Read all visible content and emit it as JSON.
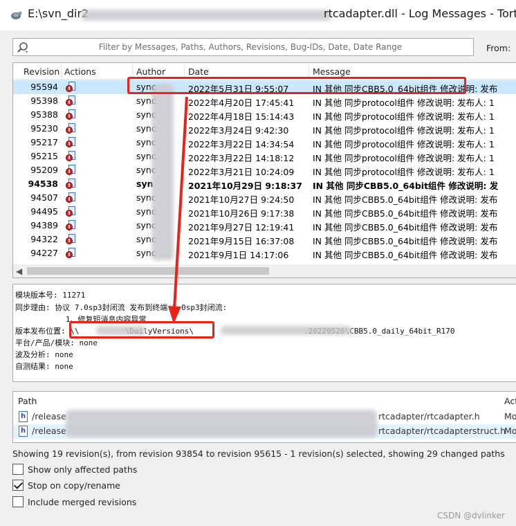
{
  "window": {
    "title_prefix": "E:\\svn_dir2",
    "title_suffix": "rtcadapter.dll - Log Messages - Tortc"
  },
  "filter": {
    "placeholder": "Filter by Messages, Paths, Authors, Revisions, Bug-IDs, Date, Date Range",
    "from_label": "From:"
  },
  "log": {
    "columns": [
      "Revision",
      "Actions",
      "Author",
      "Date",
      "Message"
    ],
    "rows": [
      {
        "revision": "95594",
        "author": "sync",
        "date": "2022年5月31日 9:55:07",
        "message": "IN 其他 同步CBB5.0_64bit组件  修改说明: 发布",
        "selected": true,
        "bold": false
      },
      {
        "revision": "95398",
        "author": "sync",
        "date": "2022年4月20日 17:45:41",
        "message": "IN 其他 同步protocol组件  修改说明: 发布人: 1",
        "selected": false,
        "bold": false
      },
      {
        "revision": "95388",
        "author": "sync",
        "date": "2022年4月18日 15:14:43",
        "message": "IN 其他 同步protocol组件  修改说明: 发布人: 1",
        "selected": false,
        "bold": false
      },
      {
        "revision": "95230",
        "author": "sync",
        "date": "2022年3月24日 9:42:30",
        "message": "IN 其他 同步protocol组件  修改说明: 发布人: 1",
        "selected": false,
        "bold": false
      },
      {
        "revision": "95217",
        "author": "sync",
        "date": "2022年3月22日 14:34:54",
        "message": "IN 其他 同步protocol组件  修改说明: 发布人: 1",
        "selected": false,
        "bold": false
      },
      {
        "revision": "95215",
        "author": "sync",
        "date": "2022年3月22日 14:18:12",
        "message": "IN 其他 同步protocol组件  修改说明: 发布人: 1",
        "selected": false,
        "bold": false
      },
      {
        "revision": "95209",
        "author": "sync",
        "date": "2022年3月21日 10:24:09",
        "message": "IN 其他 同步protocol组件  修改说明: 发布人: 1",
        "selected": false,
        "bold": false
      },
      {
        "revision": "94538",
        "author": "syn",
        "date": "2021年10月29日 9:18:37",
        "message": "IN 其他 同步CBB5.0_64bit组件  修改说明: 发",
        "selected": false,
        "bold": true
      },
      {
        "revision": "94507",
        "author": "sync",
        "date": "2021年10月27日 9:24:50",
        "message": "IN 其他 同步CBB5.0_64bit组件  修改说明: 发布",
        "selected": false,
        "bold": false
      },
      {
        "revision": "94495",
        "author": "sync",
        "date": "2021年10月26日 9:17:38",
        "message": "IN 其他 同步CBB5.0_64bit组件  修改说明: 发布",
        "selected": false,
        "bold": false
      },
      {
        "revision": "94389",
        "author": "sync",
        "date": "2021年9月27日 12:19:41",
        "message": "IN 其他 同步CBB5.0_64bit组件  修改说明: 发布",
        "selected": false,
        "bold": false
      },
      {
        "revision": "94322",
        "author": "sync",
        "date": "2021年9月15日 16:37:08",
        "message": "IN 其他 同步CBB5.0_64bit组件  修改说明: 发布",
        "selected": false,
        "bold": false
      },
      {
        "revision": "94227",
        "author": "sync",
        "date": "2021年9月1日 14:17:06",
        "message": "IN 其他 同步CBB5.0_64bit组件  修改说明: 发布",
        "selected": false,
        "bold": false
      }
    ]
  },
  "detail": {
    "lines": [
      "模块版本号: 11271",
      "同步理由: 协议 7.0sp3封闭流 发布到终端 7.0sp3封闭流:",
      "           1、修复短消息内容异常",
      "版本发布位置: \\\\          \\DailyVersions\\                        .20220526\\CBB5.0_daily_64bit_R170",
      "平台/产品/模块: none",
      "波及分析: none",
      "自测结果: none"
    ]
  },
  "paths": {
    "columns": [
      "Path",
      "Act"
    ],
    "rows": [
      {
        "prefix": "/release",
        "suffix": "rtcadapter/rtcadapter.h",
        "action": "Mo",
        "selected": false
      },
      {
        "prefix": "/release",
        "suffix": "rtcadapter/rtcadapterstruct.h",
        "action": "Mo",
        "selected": true
      }
    ]
  },
  "status": "Showing 19 revision(s), from revision 93854 to revision 95615 - 1 revision(s) selected, showing 29 changed paths",
  "options": [
    {
      "label": "Show only affected paths",
      "checked": false
    },
    {
      "label": "Stop on copy/rename",
      "checked": true
    },
    {
      "label": "Include merged revisions",
      "checked": false
    }
  ],
  "watermark": "CSDN @dvlinker",
  "icons": {
    "app": "tortoise-icon",
    "search": "search-icon",
    "action": "modified-action-icon",
    "file": "header-file-icon"
  },
  "colors": {
    "selection": "#cce8ff",
    "highlight_box": "#e8241a"
  }
}
